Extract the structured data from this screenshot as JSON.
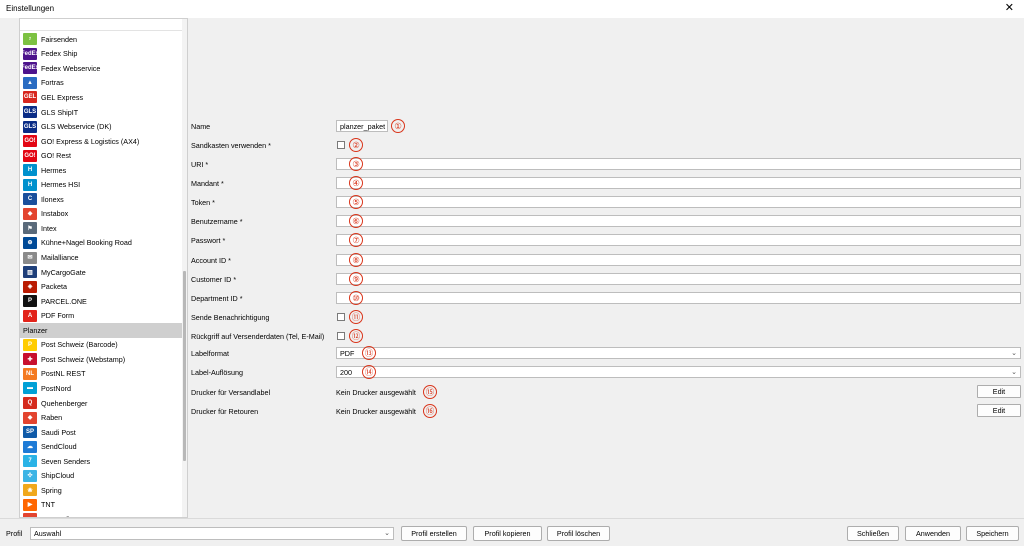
{
  "window": {
    "title": "Einstellungen",
    "close_glyph": "✕"
  },
  "sidebar": {
    "items": [
      {
        "label": "Fairsenden",
        "icon": "fairsenden-icon",
        "badge": "⸗",
        "color": "#7cc142"
      },
      {
        "label": "Fedex Ship",
        "icon": "fedex-icon",
        "badge": "FedEx",
        "color": "#4d148c"
      },
      {
        "label": "Fedex Webservice",
        "icon": "fedex-icon",
        "badge": "FedEx",
        "color": "#4d148c"
      },
      {
        "label": "Fortras",
        "icon": "fortras-icon",
        "badge": "▲",
        "color": "#2a6cc2"
      },
      {
        "label": "GEL Express",
        "icon": "gel-express-icon",
        "badge": "GEL",
        "color": "#d7261e"
      },
      {
        "label": "GLS ShipIT",
        "icon": "gls-icon",
        "badge": "GLS",
        "color": "#0a2c86"
      },
      {
        "label": "GLS Webservice (DK)",
        "icon": "gls-icon",
        "badge": "GLS",
        "color": "#0a2c86"
      },
      {
        "label": "GO! Express & Logistics (AX4)",
        "icon": "go-express-icon",
        "badge": "GO!",
        "color": "#e30613"
      },
      {
        "label": "GO! Rest",
        "icon": "go-express-icon",
        "badge": "GO!",
        "color": "#e30613"
      },
      {
        "label": "Hermes",
        "icon": "hermes-icon",
        "badge": "H",
        "color": "#0091cd"
      },
      {
        "label": "Hermes HSI",
        "icon": "hermes-icon",
        "badge": "H",
        "color": "#0091cd"
      },
      {
        "label": "Ilonexs",
        "icon": "ilonexs-icon",
        "badge": "C",
        "color": "#1a4f9c"
      },
      {
        "label": "Instabox",
        "icon": "instabox-icon",
        "badge": "◆",
        "color": "#e3442f"
      },
      {
        "label": "Intex",
        "icon": "intex-icon",
        "badge": "⚑",
        "color": "#5a6a7a"
      },
      {
        "label": "Kühne+Nagel Booking Road",
        "icon": "kuehne-nagel-icon",
        "badge": "⊕",
        "color": "#004a97"
      },
      {
        "label": "Mailalliance",
        "icon": "mail-icon",
        "badge": "✉",
        "color": "#8a8a8a"
      },
      {
        "label": "MyCargoGate",
        "icon": "mycargogate-icon",
        "badge": "▥",
        "color": "#1f3f7a"
      },
      {
        "label": "Packeta",
        "icon": "packeta-icon",
        "badge": "◈",
        "color": "#ba1b02"
      },
      {
        "label": "PARCEL.ONE",
        "icon": "parcel-one-icon",
        "badge": "P",
        "color": "#111111"
      },
      {
        "label": "PDF Form",
        "icon": "pdf-icon",
        "badge": "A",
        "color": "#e2231a"
      },
      {
        "label": "Planzer",
        "icon": "",
        "badge": "",
        "color": "",
        "selected": true
      },
      {
        "label": "Post Schweiz (Barcode)",
        "icon": "post-schweiz-icon",
        "badge": "P",
        "color": "#ffcc00"
      },
      {
        "label": "Post Schweiz (Webstamp)",
        "icon": "post-schweiz-icon",
        "badge": "✚",
        "color": "#c8102e"
      },
      {
        "label": "PostNL REST",
        "icon": "postnl-icon",
        "badge": "NL",
        "color": "#f47920"
      },
      {
        "label": "PostNord",
        "icon": "postnord-icon",
        "badge": "▬",
        "color": "#00a0d6"
      },
      {
        "label": "Quehenberger",
        "icon": "quehenberger-icon",
        "badge": "Q",
        "color": "#d52b1e"
      },
      {
        "label": "Raben",
        "icon": "raben-icon",
        "badge": "◆",
        "color": "#e3442f"
      },
      {
        "label": "Saudi Post",
        "icon": "saudi-post-icon",
        "badge": "SP",
        "color": "#0f5aa8"
      },
      {
        "label": "SendCloud",
        "icon": "sendcloud-icon",
        "badge": "☁",
        "color": "#1e7bd6"
      },
      {
        "label": "Seven Senders",
        "icon": "seven-senders-icon",
        "badge": "7",
        "color": "#2bb3e6"
      },
      {
        "label": "ShipCloud",
        "icon": "shipcloud-icon",
        "badge": "✣",
        "color": "#3cb4e5"
      },
      {
        "label": "Spring",
        "icon": "spring-icon",
        "badge": "❀",
        "color": "#f0a81c"
      },
      {
        "label": "TNT",
        "icon": "tnt-icon",
        "badge": "▶",
        "color": "#ff6600"
      },
      {
        "label": "trans-o-flex",
        "icon": "trans-o-flex-icon",
        "badge": "◆",
        "color": "#e3442f"
      }
    ]
  },
  "form": {
    "name": {
      "label": "Name",
      "value": "planzer_paket",
      "marker": "①"
    },
    "sandbox": {
      "label": "Sandkasten verwenden *",
      "marker": "②"
    },
    "uri": {
      "label": "URI *",
      "value": "",
      "marker": "③"
    },
    "mandant": {
      "label": "Mandant *",
      "value": "",
      "marker": "④"
    },
    "token": {
      "label": "Token *",
      "value": "",
      "marker": "⑤"
    },
    "username": {
      "label": "Benutzername *",
      "value": "",
      "marker": "⑥"
    },
    "password": {
      "label": "Passwort *",
      "value": "",
      "marker": "⑦"
    },
    "account_id": {
      "label": "Account ID *",
      "value": "",
      "marker": "⑧"
    },
    "customer_id": {
      "label": "Customer ID *",
      "value": "",
      "marker": "⑨"
    },
    "department_id": {
      "label": "Department ID *",
      "value": "",
      "marker": "⑩"
    },
    "notify": {
      "label": "Sende Benachrichtigung",
      "marker": "⑪"
    },
    "fallback": {
      "label": "Rückgriff auf Versenderdaten (Tel, E-Mail)",
      "marker": "⑫"
    },
    "label_format": {
      "label": "Labelformat",
      "value": "PDF",
      "marker": "⑬"
    },
    "label_resolution": {
      "label": "Label-Auflösung",
      "value": "200",
      "marker": "⑭"
    },
    "printer_shipping": {
      "label": "Drucker für Versandlabel",
      "value": "Kein Drucker ausgewählt",
      "marker": "⑮",
      "button": "Edit"
    },
    "printer_returns": {
      "label": "Drucker für Retouren",
      "value": "Kein Drucker ausgewählt",
      "marker": "⑯",
      "button": "Edit"
    }
  },
  "bottom": {
    "profile_label": "Profil",
    "profile_value": "Auswahl",
    "create_profile": "Profil erstellen",
    "copy_profile": "Profil kopieren",
    "delete_profile": "Profil löschen",
    "close": "Schließen",
    "apply": "Anwenden",
    "save": "Speichern"
  },
  "colors": {
    "marker": "#d9351b",
    "selection": "#cfcfcf"
  }
}
